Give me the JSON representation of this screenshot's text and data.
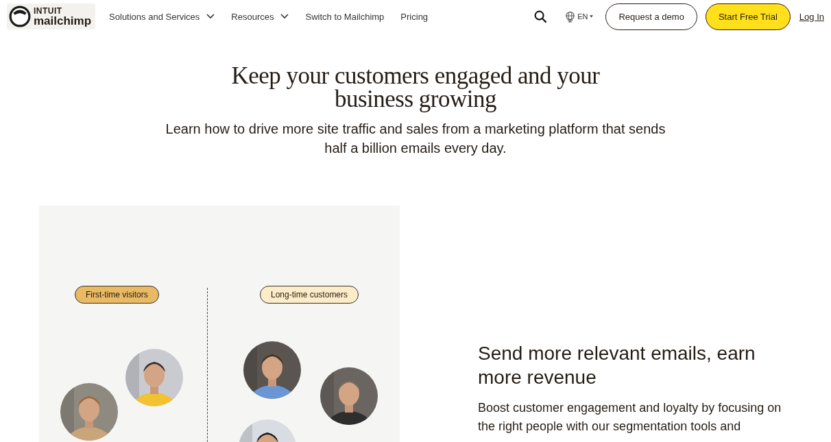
{
  "logo": {
    "top": "INTUIT",
    "bottom": "mailchimp"
  },
  "nav": [
    {
      "label": "Solutions and Services",
      "dropdown": true
    },
    {
      "label": "Resources",
      "dropdown": true
    },
    {
      "label": "Switch to Mailchimp",
      "dropdown": false
    },
    {
      "label": "Pricing",
      "dropdown": false
    }
  ],
  "language": "EN",
  "demo_button": "Request a demo",
  "trial_button": "Start Free Trial",
  "login_link": "Log In",
  "hero": {
    "title": "Keep your customers engaged and your business growing",
    "subtitle": "Learn how to drive more site traffic and sales from a marketing platform that sends half a billion emails every day."
  },
  "segments": [
    {
      "label": "First-time visitors",
      "color": "#e9b964"
    },
    {
      "label": "Long-time customers",
      "color": "#fdecc8"
    }
  ],
  "feature": {
    "title": "Send more relevant emails, earn more revenue",
    "body": "Boost customer engagement and loyalty by focusing on the right people with our segmentation tools and"
  }
}
